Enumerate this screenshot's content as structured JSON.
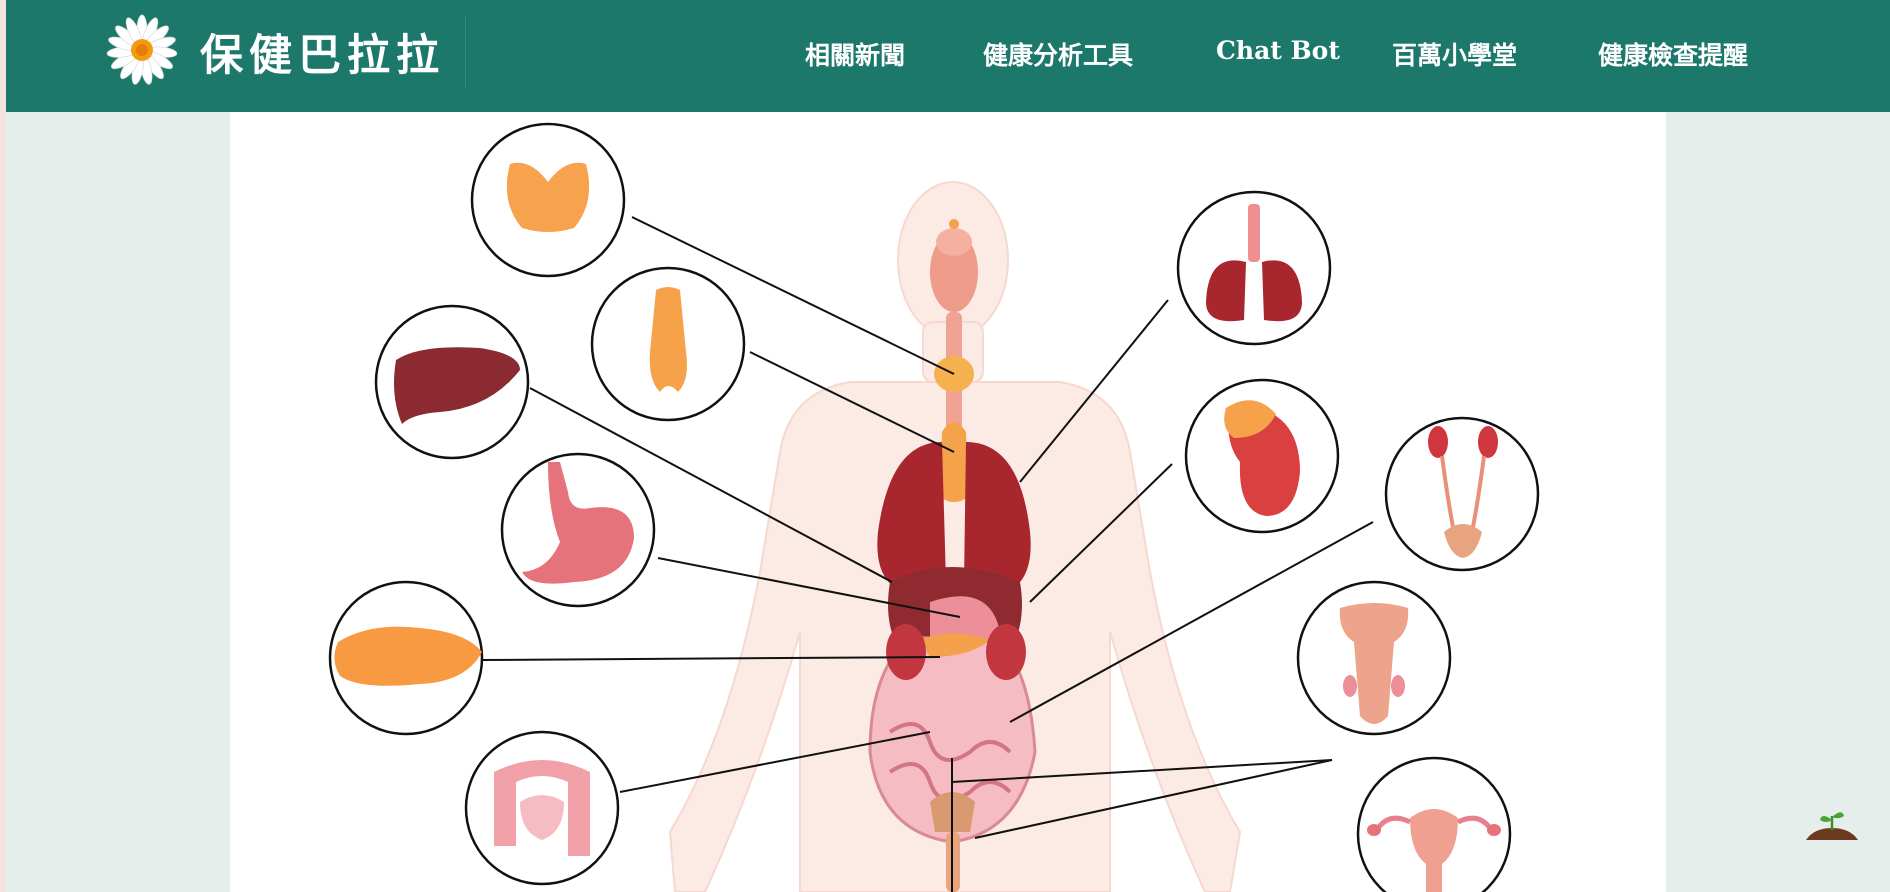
{
  "site": {
    "title": "保健巴拉拉",
    "logo_icon": "daisy-flower-icon"
  },
  "nav": {
    "items": [
      "相關新聞",
      "健康分析工具",
      "Chat Bot",
      "百萬小學堂",
      "健康檢查提醒"
    ]
  },
  "colors": {
    "header": "#1d786c",
    "page_background": "#e6eeec",
    "content_background": "#ffffff",
    "organ_red": "#a8272f",
    "organ_orange": "#f5a04a",
    "organ_pink": "#f2a0a8"
  },
  "diagram": {
    "subject": "human-body-organs-diagram",
    "callouts": [
      "thyroid",
      "thymus",
      "liver",
      "stomach",
      "pancreas",
      "large-intestine",
      "lungs",
      "spleen",
      "urinary-bladder",
      "male-reproductive-organs",
      "uterus"
    ]
  },
  "floating_icon": "plant-sprout-icon"
}
